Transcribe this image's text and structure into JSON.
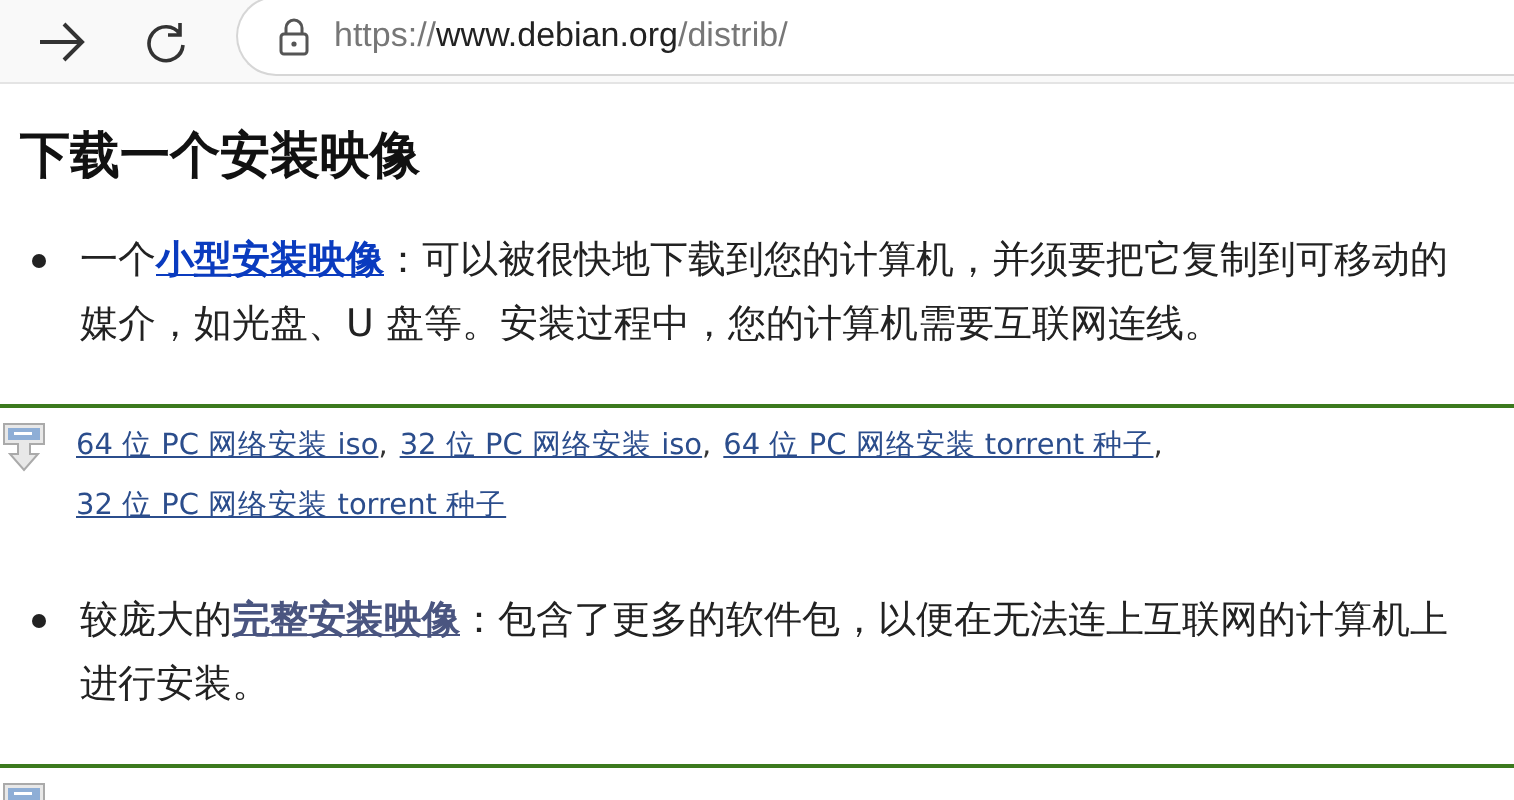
{
  "browser": {
    "url_scheme": "https://",
    "url_host": "www.debian.org",
    "url_path": "/distrib/"
  },
  "heading": "下载一个安装映像",
  "sections": [
    {
      "before": "一个",
      "link": "小型安装映像",
      "visited": false,
      "after": "：可以被很快地下载到您的计算机，并须要把它复制到可移动的媒介，如光盘、U 盘等。安装过程中，您的计算机需要互联网连线。",
      "downloads": [
        {
          "kind": "link",
          "text": "64 位 PC 网络安装 iso"
        },
        {
          "kind": "separator",
          "text": ","
        },
        {
          "kind": "link",
          "text": "32 位 PC 网络安装 iso"
        },
        {
          "kind": "separator",
          "text": ","
        },
        {
          "kind": "link",
          "text": "64 位 PC 网络安装 torrent 种子"
        },
        {
          "kind": "separator",
          "text": ","
        },
        {
          "kind": "link",
          "text": "32 位 PC 网络安装 torrent 种子"
        }
      ]
    },
    {
      "before": "较庞大的",
      "link": "完整安装映像",
      "visited": true,
      "after": "：包含了更多的软件包，以便在无法连上互联网的计算机上进行安装。"
    }
  ]
}
